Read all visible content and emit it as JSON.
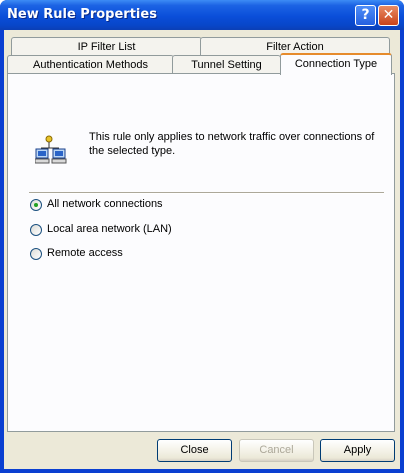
{
  "window": {
    "title": "New Rule Properties"
  },
  "titlebar": {
    "help_glyph": "?",
    "close_glyph": "✕"
  },
  "tabs": {
    "row1": [
      "IP Filter List",
      "Filter Action"
    ],
    "row2": [
      "Authentication Methods",
      "Tunnel Setting",
      "Connection Type"
    ],
    "active": "Connection Type"
  },
  "panel": {
    "description": "This rule only applies to network traffic over connections of the selected type.",
    "icon": "network-computers-icon",
    "options": [
      {
        "label": "All network connections",
        "checked": true
      },
      {
        "label": "Local area network (LAN)",
        "checked": false
      },
      {
        "label": "Remote access",
        "checked": false
      }
    ]
  },
  "buttons": {
    "close": "Close",
    "cancel": "Cancel",
    "apply": "Apply",
    "cancel_disabled": true
  },
  "colors": {
    "titlebar": "#0a4ed9",
    "dialog_bg": "#ece9d8",
    "tab_highlight": "#e68b2c",
    "radio_dot": "#21a121"
  }
}
